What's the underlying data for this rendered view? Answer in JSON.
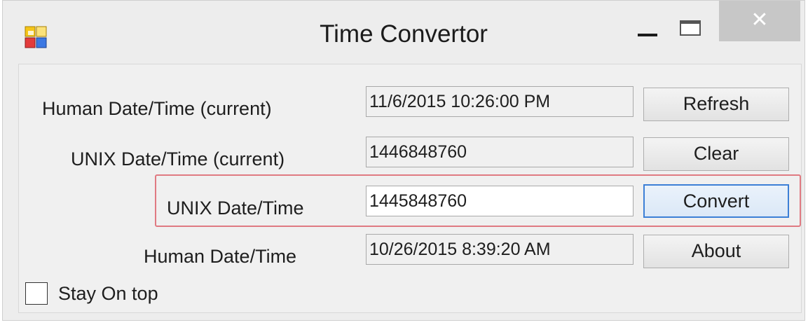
{
  "window": {
    "title": "Time Convertor",
    "close_glyph": "✕",
    "app_icon": "app-icon"
  },
  "rows": {
    "human_current": {
      "label": "Human Date/Time (current)",
      "value": "11/6/2015 10:26:00 PM",
      "button": "Refresh"
    },
    "unix_current": {
      "label": "UNIX Date/Time (current)",
      "value": "1446848760",
      "button": "Clear"
    },
    "unix_input": {
      "label": "UNIX Date/Time",
      "value": "1445848760",
      "button": "Convert"
    },
    "human_output": {
      "label": "Human Date/Time",
      "value": "10/26/2015 8:39:20 AM",
      "button": "About"
    }
  },
  "options": {
    "stay_on_top": {
      "label": "Stay On top",
      "checked": false
    }
  },
  "colors": {
    "highlight": "#e07a82",
    "focus": "#3c7fd6",
    "close_button": "#c7c7c7"
  }
}
